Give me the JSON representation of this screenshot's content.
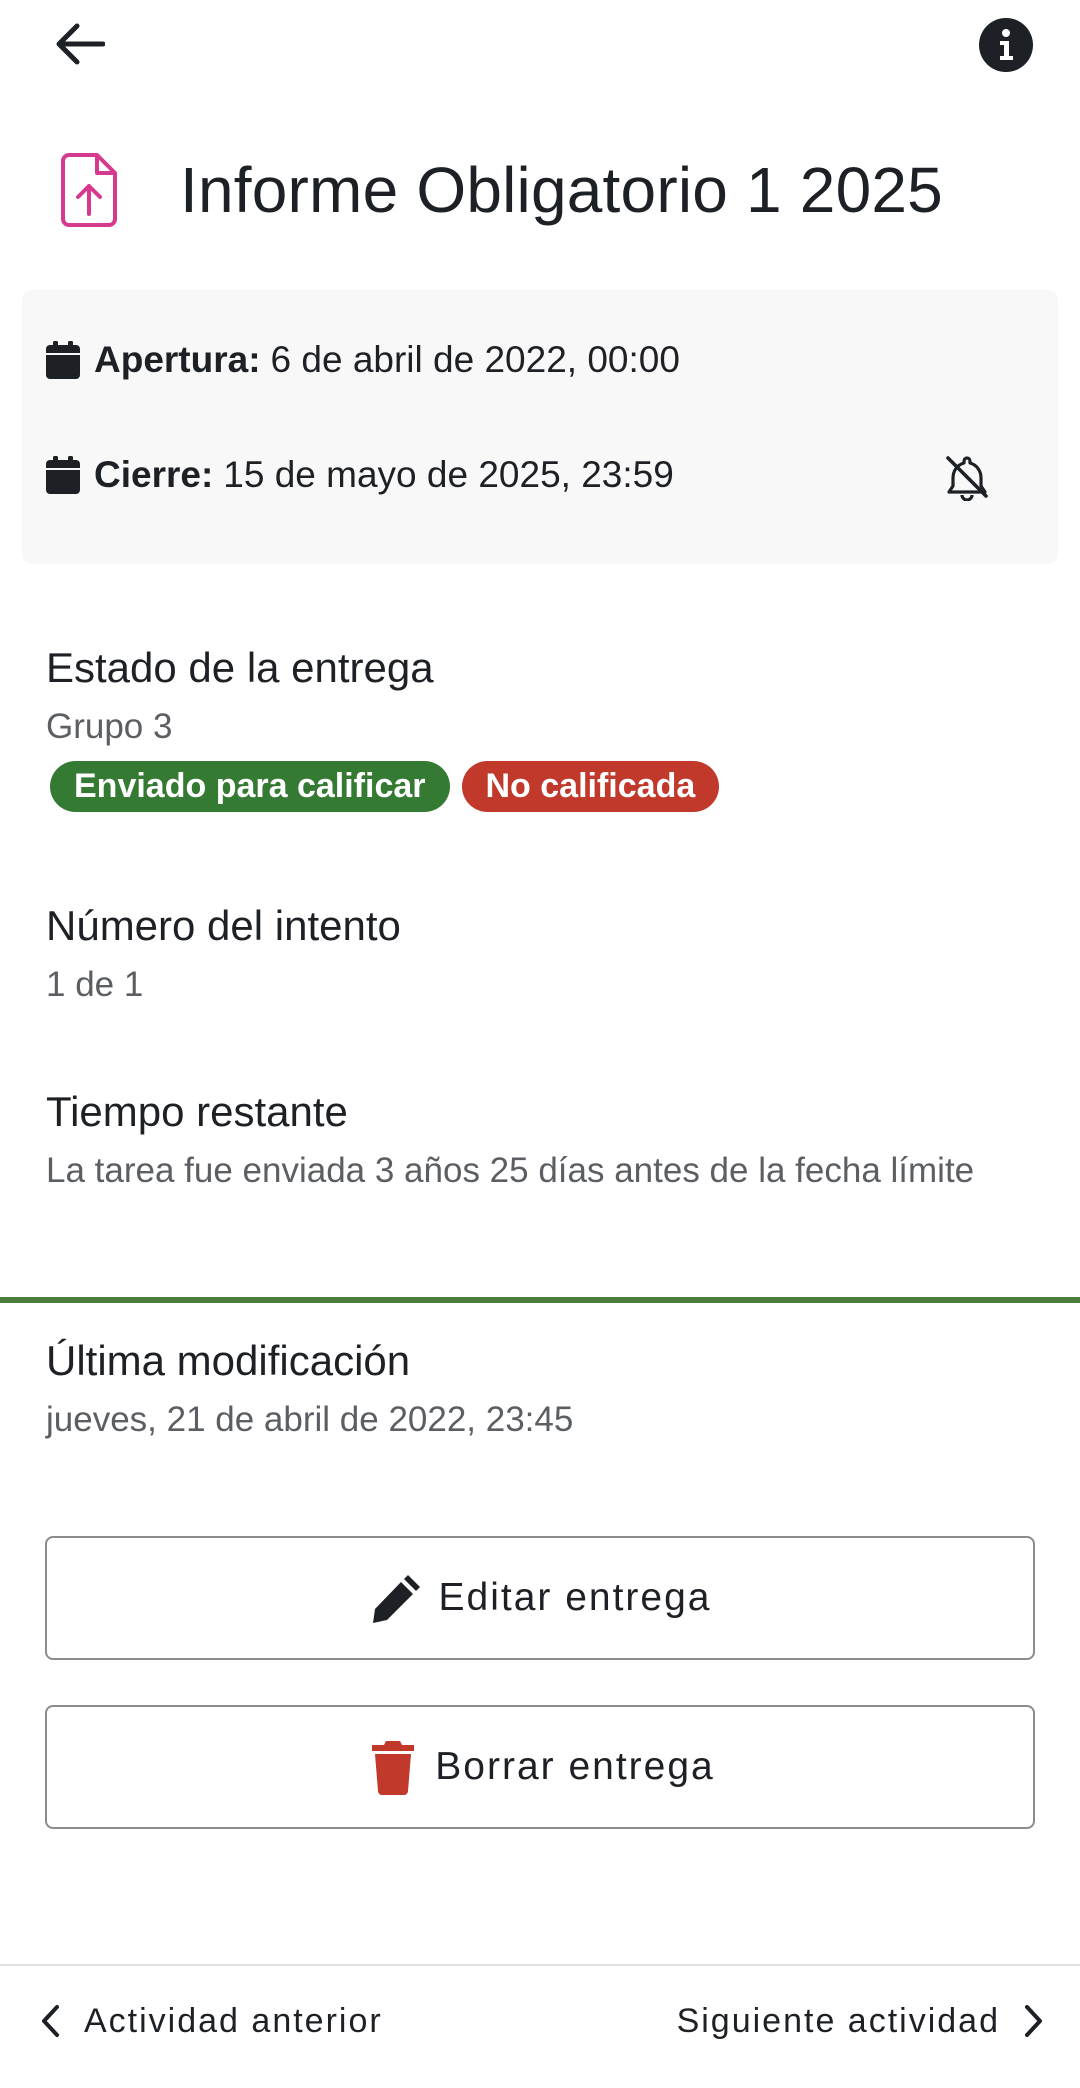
{
  "header": {
    "back_icon": "arrow-left-icon",
    "info_icon": "info-icon"
  },
  "activity": {
    "title": "Informe Obligatorio 1 2025",
    "icon": "file-upload-icon",
    "icon_color": "#d63a8f"
  },
  "dates": {
    "opening_label": "Apertura:",
    "opening_value": "6 de abril de 2022, 00:00",
    "closing_label": "Cierre:",
    "closing_value": "15 de mayo de 2025, 23:59",
    "calendar_icon": "calendar-icon",
    "notification_icon": "bell-off-icon"
  },
  "submission_status": {
    "title": "Estado de la entrega",
    "group": "Grupo 3",
    "badges": [
      {
        "label": "Enviado para calificar",
        "color": "#357a32"
      },
      {
        "label": "No calificada",
        "color": "#c0392b"
      }
    ]
  },
  "attempt": {
    "title": "Número del intento",
    "value": "1 de 1"
  },
  "time_remaining": {
    "title": "Tiempo restante",
    "value": "La tarea fue enviada 3 años 25 días antes de la fecha límite",
    "accent_color": "#4a7c3b"
  },
  "last_modified": {
    "title": "Última modificación",
    "value": "jueves, 21 de abril de 2022, 23:45"
  },
  "actions": {
    "edit_label": "Editar entrega",
    "edit_icon": "pencil-icon",
    "delete_label": "Borrar entrega",
    "delete_icon": "trash-icon",
    "delete_color": "#c0392b"
  },
  "footer": {
    "prev_label": "Actividad anterior",
    "next_label": "Siguiente actividad"
  }
}
